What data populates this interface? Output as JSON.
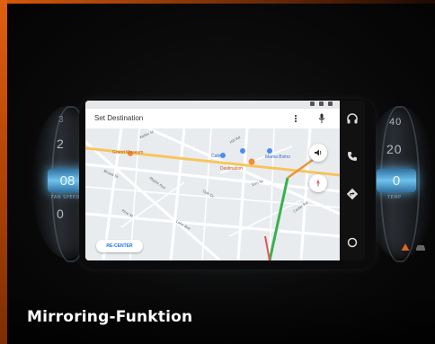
{
  "caption": "Mirroring-Funktion",
  "accent_color": "#e06010",
  "left_dial": {
    "numbers": [
      "3",
      "2",
      "0"
    ],
    "selected": "08",
    "sub": "FAN SPEED"
  },
  "right_dial": {
    "numbers": [
      "40",
      "20",
      "0"
    ],
    "selected": "0",
    "sub": "TEMP"
  },
  "nav_app": {
    "search_label": "Set Destination",
    "recenter_label": "RE-CENTER",
    "map_labels": [
      "Grand Museum",
      "Destination",
      "Cafe",
      "Mama Bistro"
    ],
    "street_labels": [
      "Keller St",
      "Broad St",
      "Maple Ave",
      "Oak Dr",
      "Pine St",
      "Elm St",
      "Cedar Rd",
      "Lake Ave",
      "Hill Rd"
    ]
  },
  "rail_icons": [
    "headphones-icon",
    "phone-icon",
    "directions-icon",
    "home-icon"
  ],
  "corner_icons": [
    "warning-icon",
    "car-icon"
  ]
}
